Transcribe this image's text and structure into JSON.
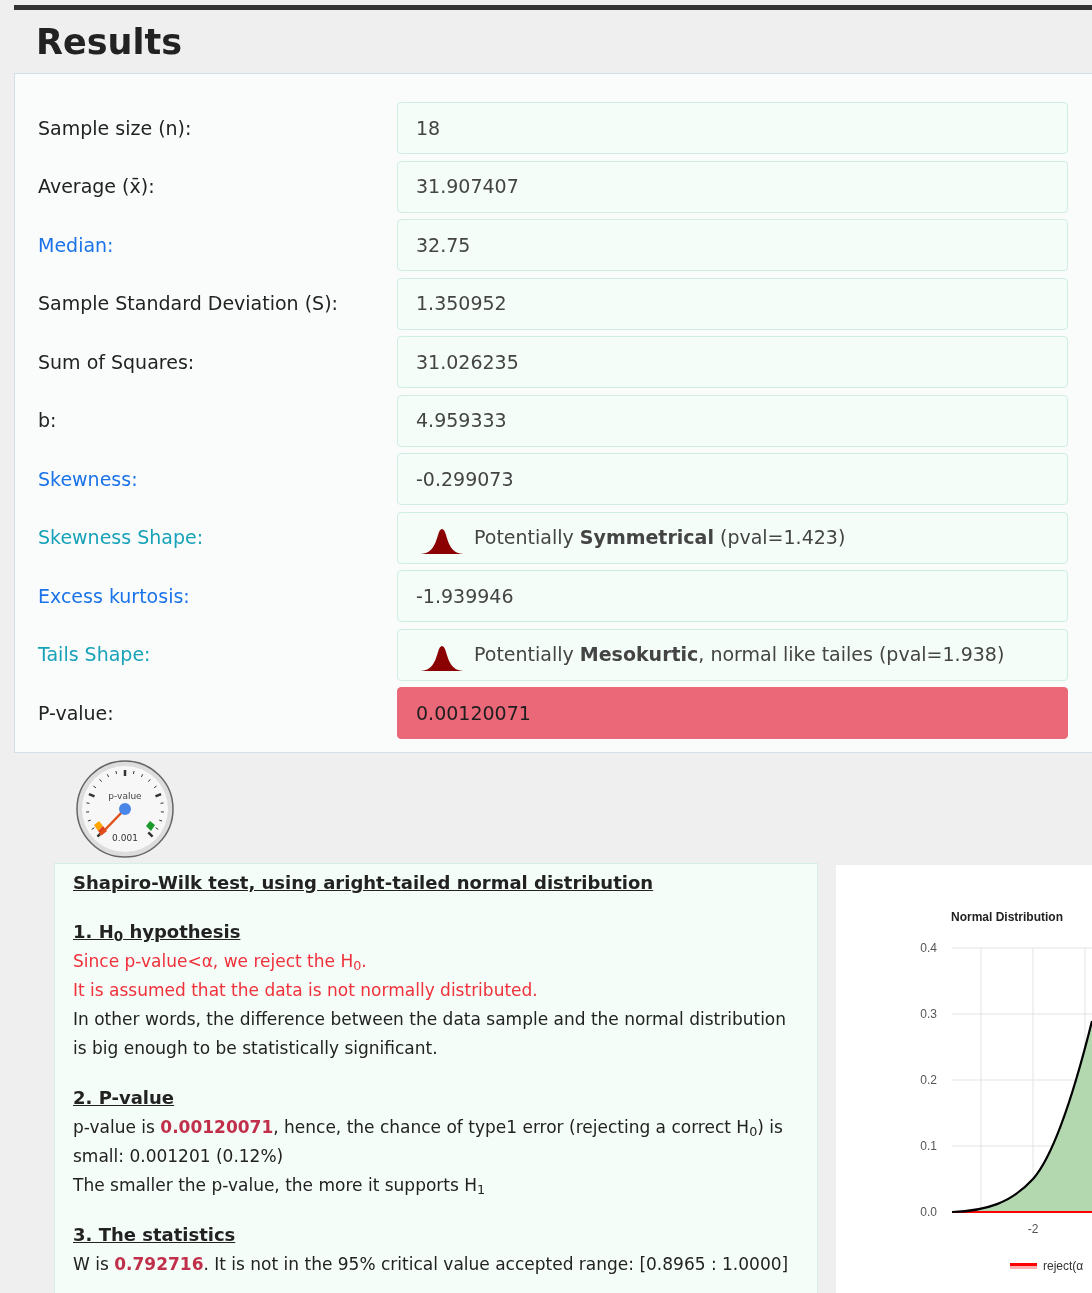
{
  "title": "Results",
  "rows": [
    {
      "kind": "plain",
      "label": "Sample size (n):",
      "value": "18",
      "highlight": false
    },
    {
      "kind": "plain",
      "label": "Average (x̄):",
      "value": "31.907407",
      "highlight": false
    },
    {
      "kind": "link",
      "label": "Median:",
      "value": "32.75",
      "highlight": false
    },
    {
      "kind": "plain",
      "label": "Sample Standard Deviation (S):",
      "value": "1.350952",
      "highlight": false
    },
    {
      "kind": "plain",
      "label": "Sum of Squares:",
      "value": "31.026235",
      "highlight": false
    },
    {
      "kind": "plain",
      "label": "b:",
      "value": "4.959333",
      "highlight": false
    },
    {
      "kind": "link",
      "label": "Skewness:",
      "value": "-0.299073",
      "highlight": false
    },
    {
      "kind": "shape",
      "label": "Skewness Shape:",
      "value": "Potentially **Symmetrical** (pval=1.423)",
      "highlight": false
    },
    {
      "kind": "link",
      "label": "Excess kurtosis:",
      "value": "-1.939946",
      "highlight": false
    },
    {
      "kind": "shape",
      "label": "Tails Shape:",
      "value": "Potentially **Mesokurtic**, normal like tailes (pval=1.938)",
      "highlight": false
    },
    {
      "kind": "plain",
      "label": "P-value:",
      "value": "0.00120071",
      "highlight": true
    }
  ],
  "gauge": {
    "label": "p-value",
    "reading": "0.001"
  },
  "report": {
    "heading": "Shapiro-Wilk test, using aright-tailed normal distribution",
    "sections": [
      {
        "title": "1. H$_{0}$ hypothesis",
        "lines": [
          {
            "kind": "alert",
            "text": "Since p-value<α, we reject the H$_{0}$."
          },
          {
            "kind": "alert",
            "text": "It is assumed that the data is not normally distributed."
          },
          {
            "kind": "normal",
            "text": "In other words, the difference between the data sample and the normal distribution is big enough to be statistically significant."
          }
        ]
      },
      {
        "title": "2. P-value",
        "lines": [
          {
            "kind": "normal",
            "text": "p-value is **0.00120071**, hence, the chance of type1 error (rejecting a correct H$_{0}$) is small: 0.001201 (0.12%)"
          },
          {
            "kind": "normal",
            "text": "The smaller the p-value, the more it supports H$_{1}$"
          }
        ]
      },
      {
        "title": "3. The statistics",
        "lines": [
          {
            "kind": "normal",
            "text": "W is **0.792716**. It is not in the 95% critical value accepted range: [0.8965 : 1.0000]"
          }
        ]
      }
    ]
  },
  "chart": {
    "title": "Normal Distribution",
    "y_tick_labels": [
      "0.4",
      "0.3",
      "0.2",
      "0.1",
      "0.0"
    ],
    "x_tick_labels": [
      "-2"
    ],
    "legend": [
      "reject(α"
    ]
  }
}
